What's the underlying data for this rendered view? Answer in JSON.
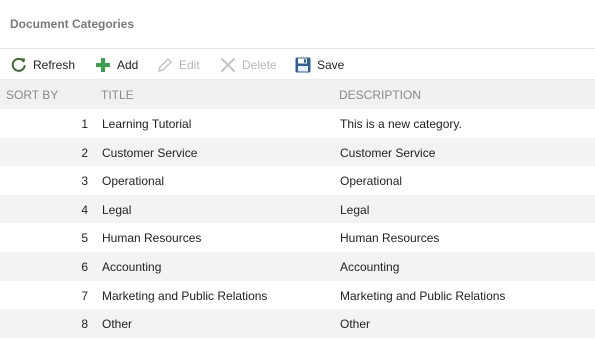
{
  "header": {
    "title": "Document Categories"
  },
  "toolbar": {
    "refresh_label": "Refresh",
    "add_label": "Add",
    "edit_label": "Edit",
    "delete_label": "Delete",
    "save_label": "Save",
    "colors": {
      "refresh_icon": "#3d6b2f",
      "add_icon": "#3aa04a",
      "disabled": "#b8b8b8",
      "save_icon": "#2f5f8f"
    }
  },
  "grid": {
    "columns": [
      "SORT BY",
      "TITLE",
      "DESCRIPTION"
    ],
    "rows": [
      {
        "sort": "1",
        "title": "Learning Tutorial",
        "description": "This is a new category."
      },
      {
        "sort": "2",
        "title": "Customer Service",
        "description": "Customer Service"
      },
      {
        "sort": "3",
        "title": "Operational",
        "description": "Operational"
      },
      {
        "sort": "4",
        "title": "Legal",
        "description": "Legal"
      },
      {
        "sort": "5",
        "title": "Human Resources",
        "description": "Human Resources"
      },
      {
        "sort": "6",
        "title": "Accounting",
        "description": "Accounting"
      },
      {
        "sort": "7",
        "title": "Marketing and Public Relations",
        "description": "Marketing and Public Relations"
      },
      {
        "sort": "8",
        "title": "Other",
        "description": "Other"
      }
    ]
  }
}
